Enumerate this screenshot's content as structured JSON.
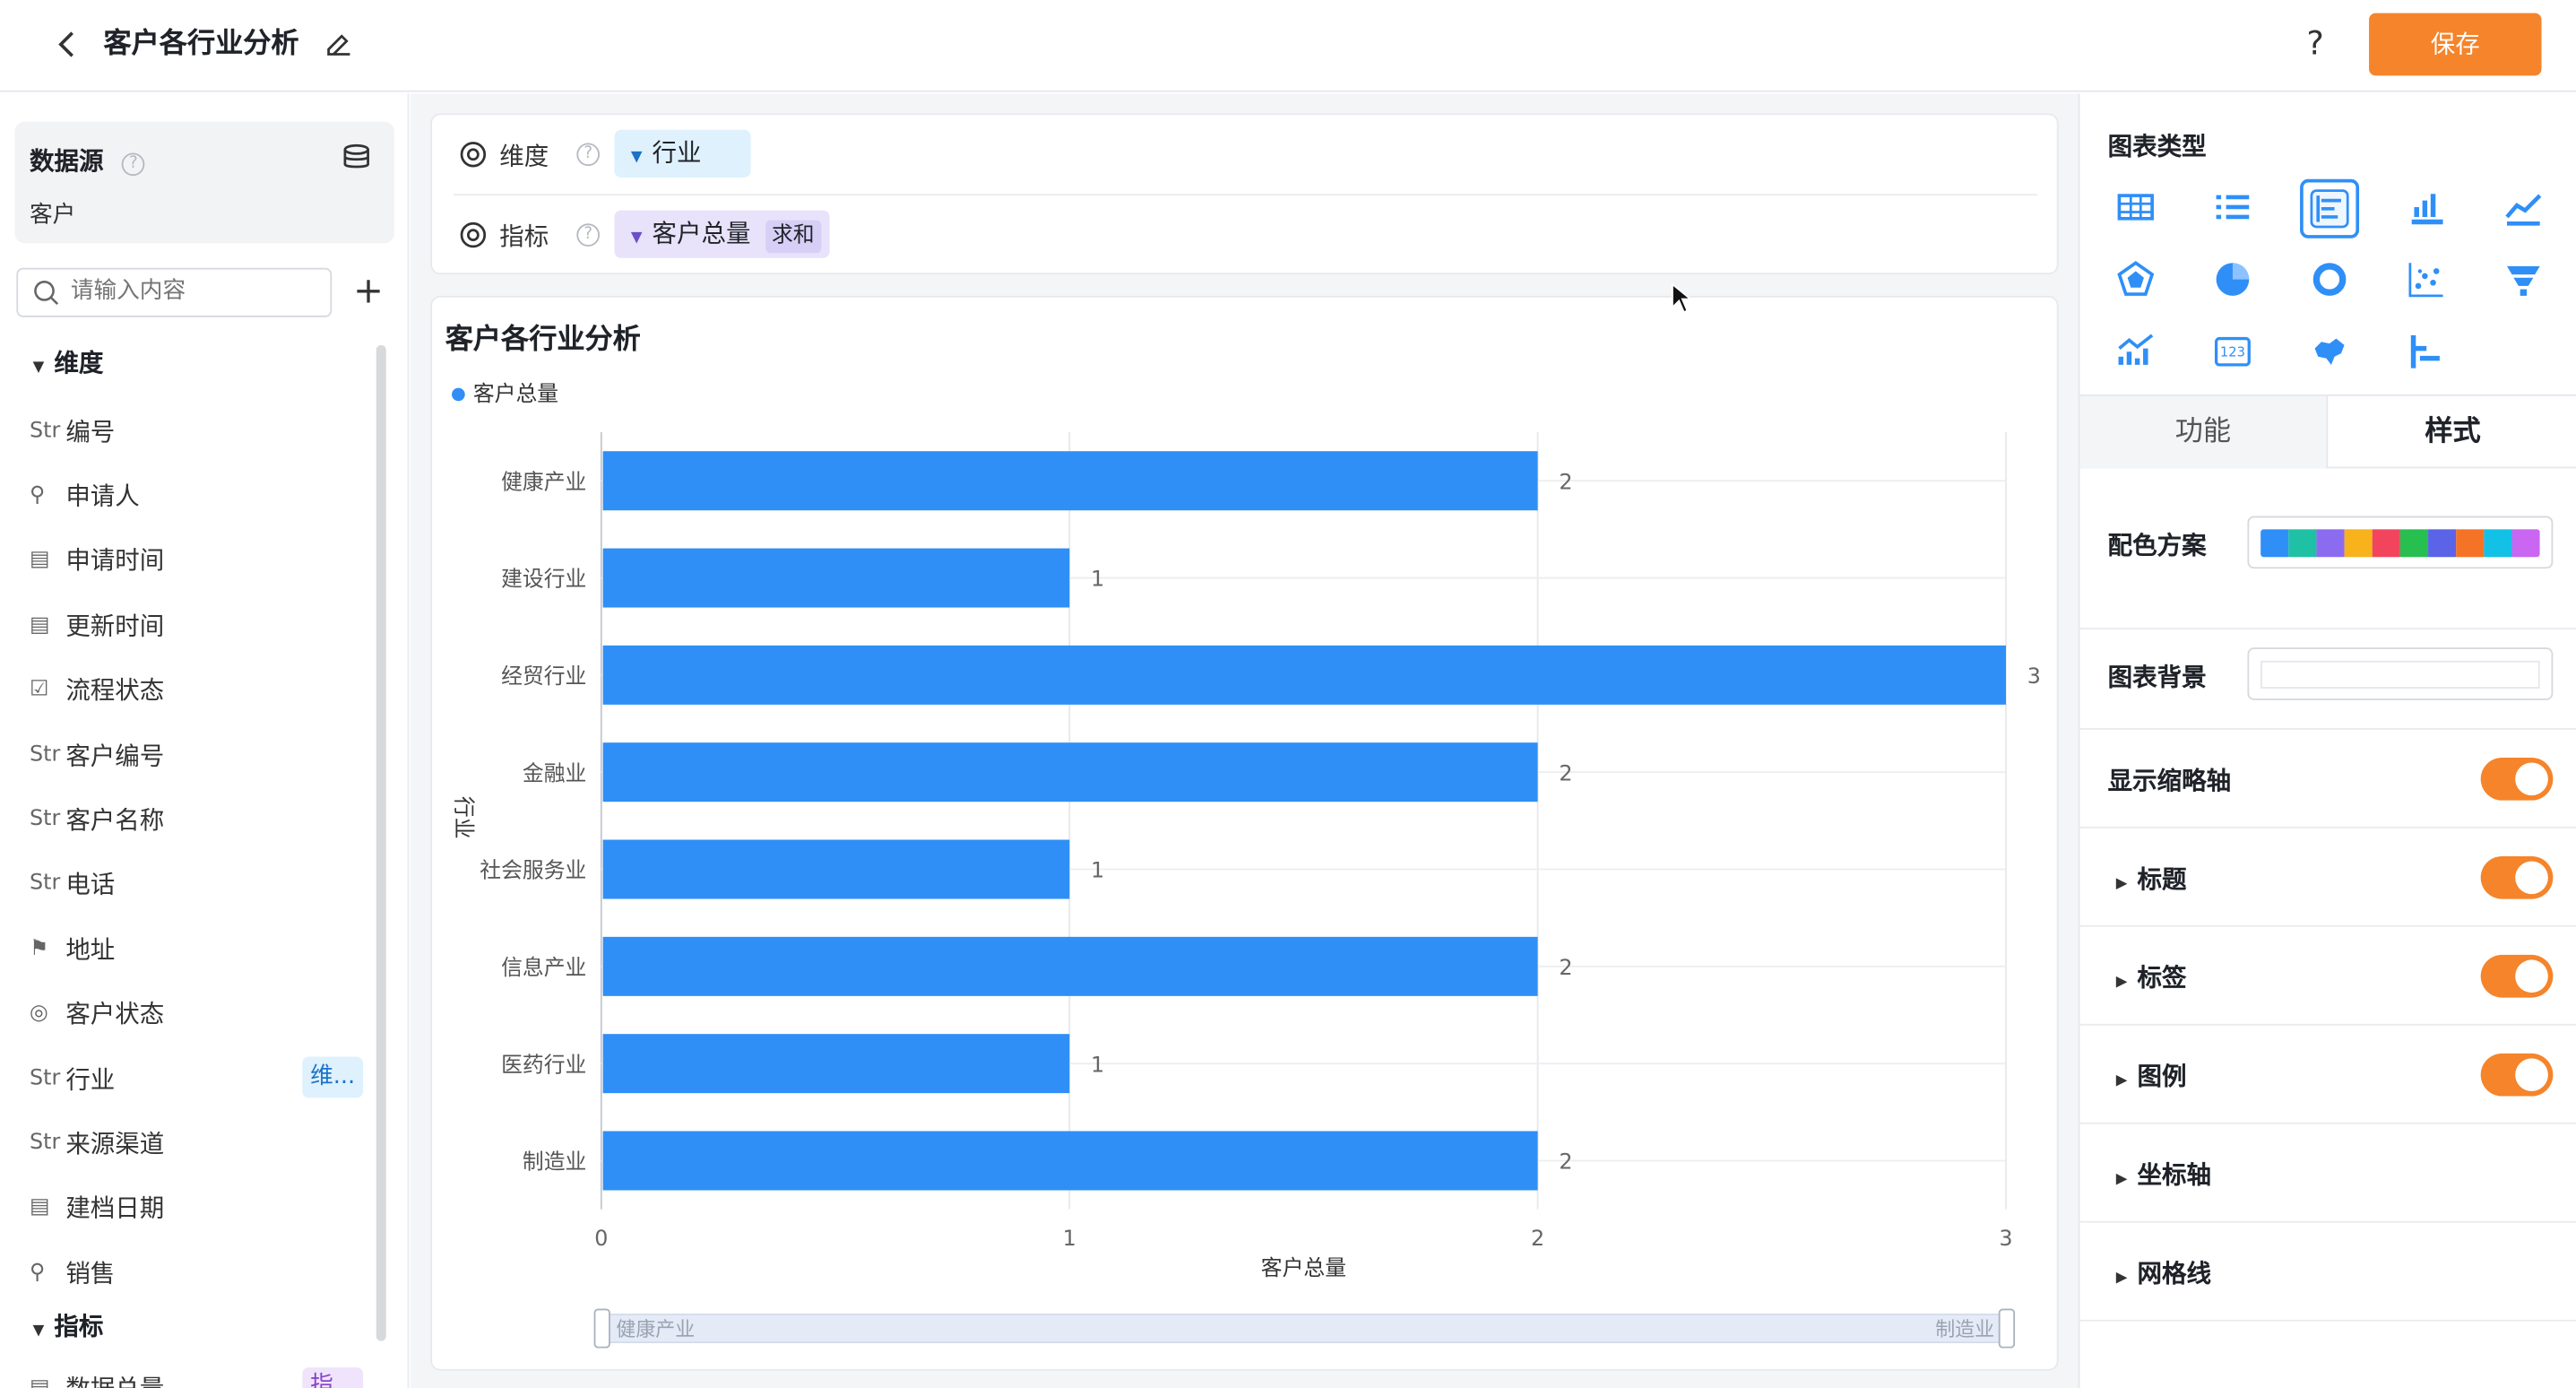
{
  "header": {
    "title": "客户各行业分析",
    "help_label": "?",
    "save_label": "保存"
  },
  "datasource": {
    "title": "数据源",
    "help": "?",
    "name": "客户"
  },
  "search": {
    "placeholder": "请输入内容",
    "add_label": "+"
  },
  "fields": {
    "dimensions_title": "维度",
    "metrics_title": "指标",
    "items": [
      {
        "type_label": "Str",
        "icon": "string-icon",
        "name": "编号"
      },
      {
        "type_label": "",
        "icon": "person-icon",
        "name": "申请人"
      },
      {
        "type_label": "",
        "icon": "calendar-icon",
        "name": "申请时间"
      },
      {
        "type_label": "",
        "icon": "calendar-icon",
        "name": "更新时间"
      },
      {
        "type_label": "",
        "icon": "checkbox-icon",
        "name": "流程状态"
      },
      {
        "type_label": "Str",
        "icon": "string-icon",
        "name": "客户编号"
      },
      {
        "type_label": "Str",
        "icon": "string-icon",
        "name": "客户名称"
      },
      {
        "type_label": "Str",
        "icon": "string-icon",
        "name": "电话"
      },
      {
        "type_label": "",
        "icon": "location-icon",
        "name": "地址"
      },
      {
        "type_label": "",
        "icon": "radio-icon",
        "name": "客户状态"
      },
      {
        "type_label": "Str",
        "icon": "string-icon",
        "name": "行业",
        "tag": "维..."
      },
      {
        "type_label": "Str",
        "icon": "string-icon",
        "name": "来源渠道"
      },
      {
        "type_label": "",
        "icon": "calendar-icon",
        "name": "建档日期"
      },
      {
        "type_label": "",
        "icon": "person-icon",
        "name": "销售"
      }
    ],
    "metric_items": [
      {
        "name": "数据总量",
        "tag": "指..."
      }
    ]
  },
  "shelf": {
    "dimension_label": "维度",
    "dimension_value": "行业",
    "metric_label": "指标",
    "metric_value": "客户总量",
    "metric_agg": "求和",
    "help": "?"
  },
  "chart_data": {
    "type": "bar",
    "orientation": "horizontal",
    "title": "客户各行业分析",
    "categories": [
      "健康产业",
      "建设行业",
      "经贸行业",
      "金融业",
      "社会服务业",
      "信息产业",
      "医药行业",
      "制造业"
    ],
    "series": [
      {
        "name": "客户总量",
        "values": [
          2,
          1,
          3,
          2,
          1,
          2,
          1,
          2
        ],
        "color": "#2f8ff7"
      }
    ],
    "xlabel": "客户总量",
    "ylabel": "行业",
    "xlim": [
      0,
      3
    ],
    "xticks": [
      "0",
      "1",
      "2",
      "3"
    ],
    "grid": true,
    "legend": "top-left",
    "zoom_start_label": "健康产业",
    "zoom_end_label": "制造业"
  },
  "right_panel": {
    "chart_type_title": "图表类型",
    "chart_types": [
      "table-icon",
      "list-icon",
      "horizontal-bar-icon",
      "bar-icon",
      "line-icon",
      "radar-icon",
      "pie-icon",
      "donut-icon",
      "scatter-icon",
      "funnel-icon",
      "combo-icon",
      "number-card-icon",
      "map-icon",
      "gantt-icon"
    ],
    "selected_chart_type": "horizontal-bar-icon",
    "tab_function": "功能",
    "tab_style": "样式",
    "color_scheme_label": "配色方案",
    "color_scheme": [
      "#2f8ff7",
      "#1fc1a4",
      "#8b6cf0",
      "#f8b21b",
      "#f2455d",
      "#27bf4f",
      "#5b63e8",
      "#f57326",
      "#12c1e5",
      "#c966f2"
    ],
    "background_label": "图表背景",
    "thumbnail_axis_label": "显示缩略轴",
    "thumbnail_axis_on": true,
    "sections": [
      {
        "label": "标题",
        "toggle": true
      },
      {
        "label": "标签",
        "toggle": true
      },
      {
        "label": "图例",
        "toggle": true
      },
      {
        "label": "坐标轴",
        "toggle": null
      },
      {
        "label": "网格线",
        "toggle": null
      }
    ]
  },
  "colors": {
    "accent": "#f5842a",
    "bar": "#2f8ff7"
  }
}
